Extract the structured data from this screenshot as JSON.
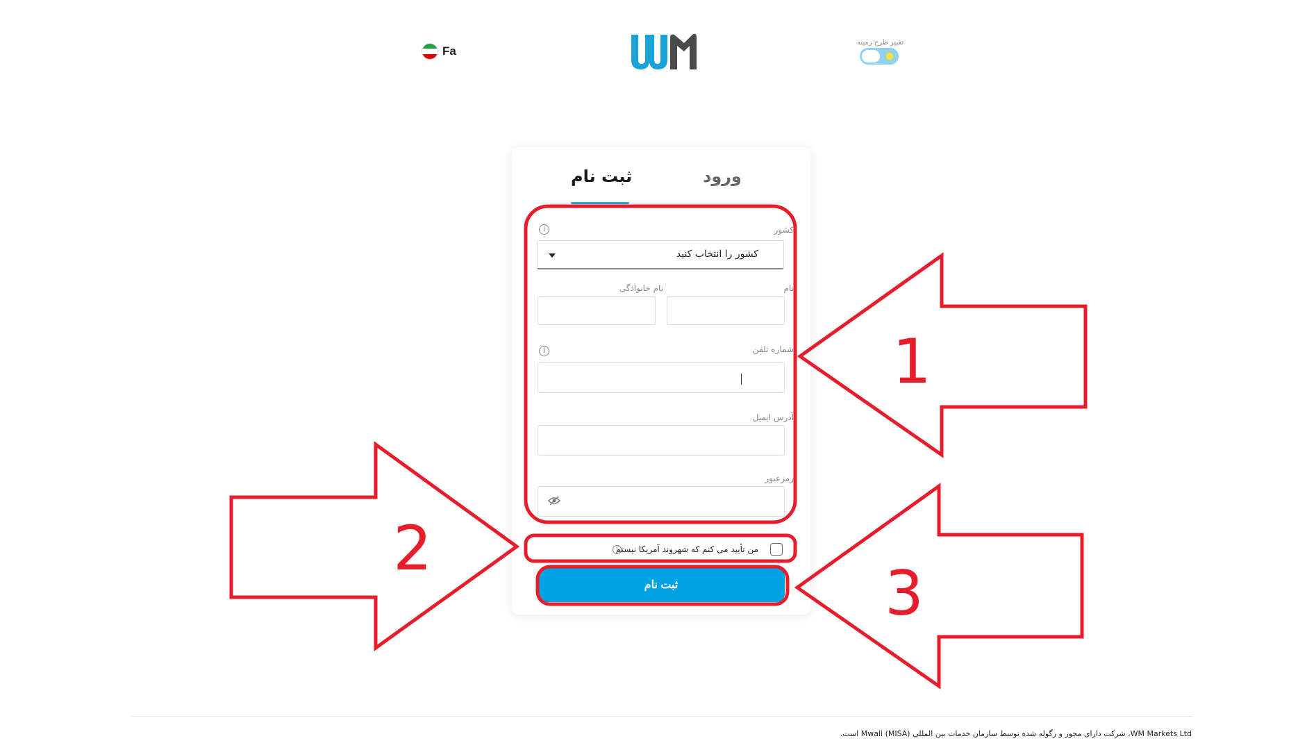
{
  "header": {
    "language": "Fa",
    "logo_text": "WM",
    "theme_label": "تغییر طرح زمینه"
  },
  "tabs": [
    {
      "label": "ثبت نام",
      "active": true
    },
    {
      "label": "ورود",
      "active": false
    }
  ],
  "form": {
    "country": {
      "label": "کشور",
      "value": "کشور را انتخاب کنید"
    },
    "first_name": {
      "label": "نام",
      "value": ""
    },
    "last_name": {
      "label": "نام خانوادگی",
      "value": ""
    },
    "phone": {
      "label": "شماره تلفن",
      "value": ""
    },
    "email": {
      "label": "آدرس ایمیل",
      "value": ""
    },
    "password": {
      "label": "رمزعبور",
      "value": ""
    },
    "us_citizen_checkbox": {
      "label": "من تأیید می کنم که شهروند آمریکا نیستم",
      "checked": false
    },
    "submit_label": "ثبت نام"
  },
  "annotations": [
    "1",
    "2",
    "3"
  ],
  "footer": {
    "text": "WM Markets Ltd، شرکت دارای مجوز و رگوله شده توسط سازمان خدمات بین المللی Mwali (MISA) است."
  },
  "colors": {
    "accent": "#00a2e4",
    "tab_underline": "#1aa3d6",
    "annotation": "#e61e2b",
    "logo_blue": "#1aa3d6",
    "logo_gray": "#4a4a4a"
  },
  "icons": [
    "iran-flag-icon",
    "info-icon",
    "caret-down-icon",
    "eye-off-icon",
    "sun-icon"
  ]
}
